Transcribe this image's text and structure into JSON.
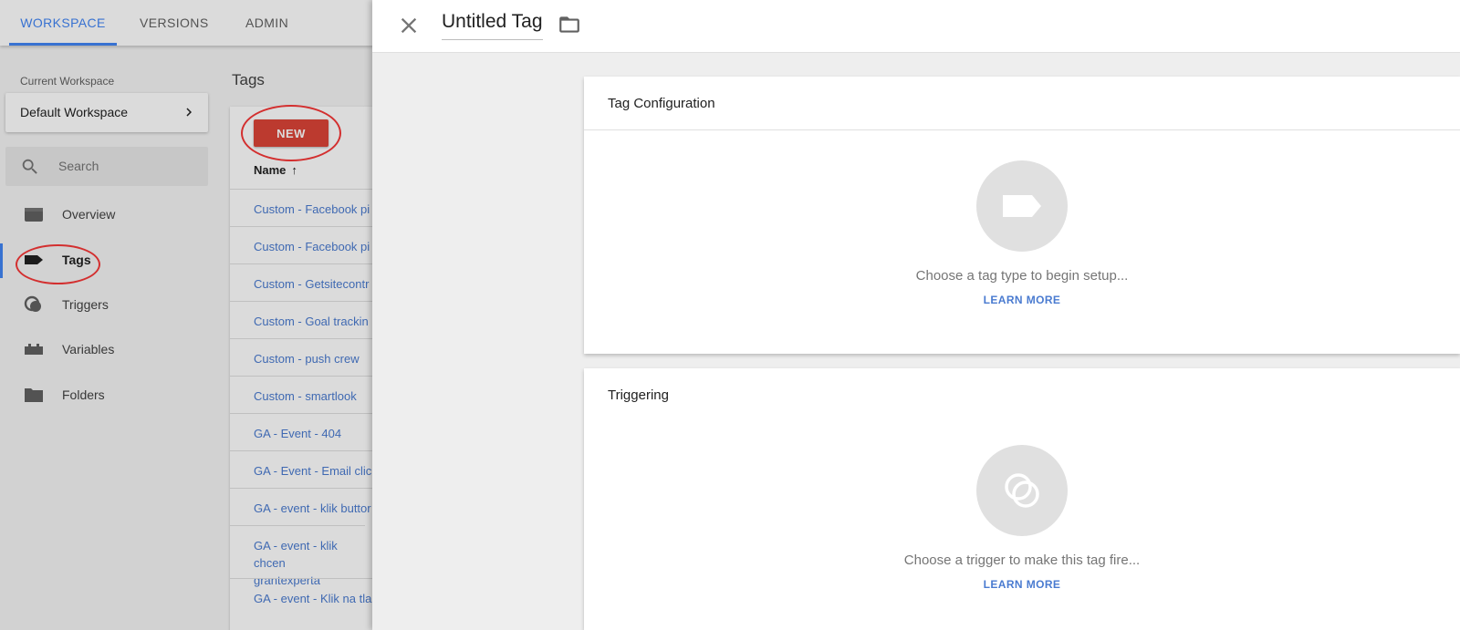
{
  "top_tabs": [
    {
      "label": "WORKSPACE",
      "active": true
    },
    {
      "label": "VERSIONS",
      "active": false
    },
    {
      "label": "ADMIN",
      "active": false
    }
  ],
  "sidebar": {
    "current_workspace_label": "Current Workspace",
    "workspace_name": "Default Workspace",
    "search_placeholder": "Search",
    "items": [
      {
        "label": "Overview",
        "icon": "overview-icon",
        "active": false
      },
      {
        "label": "Tags",
        "icon": "tag-icon",
        "active": true
      },
      {
        "label": "Triggers",
        "icon": "trigger-icon",
        "active": false
      },
      {
        "label": "Variables",
        "icon": "variables-icon",
        "active": false
      },
      {
        "label": "Folders",
        "icon": "folder-icon",
        "active": false
      }
    ]
  },
  "tags_list": {
    "heading": "Tags",
    "new_button": "NEW",
    "name_column": "Name",
    "sort_arrow": "↑",
    "rows": [
      "Custom - Facebook pi",
      "Custom - Facebook pi",
      "Custom - Getsitecontr",
      "Custom - Goal trackin",
      "Custom - push crew",
      "Custom - smartlook",
      "GA - Event - 404",
      "GA - Event - Email clic",
      "GA - event - klik buttor",
      "GA - event - klik chcen grantexperta",
      "GA - event - Klik na tla"
    ]
  },
  "panel": {
    "title": "Untitled Tag",
    "tag_configuration": {
      "title": "Tag Configuration",
      "prompt": "Choose a tag type to begin setup...",
      "learn_more": "LEARN MORE"
    },
    "triggering": {
      "title": "Triggering",
      "prompt": "Choose a trigger to make this tag fire...",
      "learn_more": "LEARN MORE"
    }
  },
  "colors": {
    "accent_blue": "#4285f4",
    "new_button_red": "#db4437",
    "annotation_red": "#d32f2f",
    "link_blue": "#4a7bd0"
  }
}
